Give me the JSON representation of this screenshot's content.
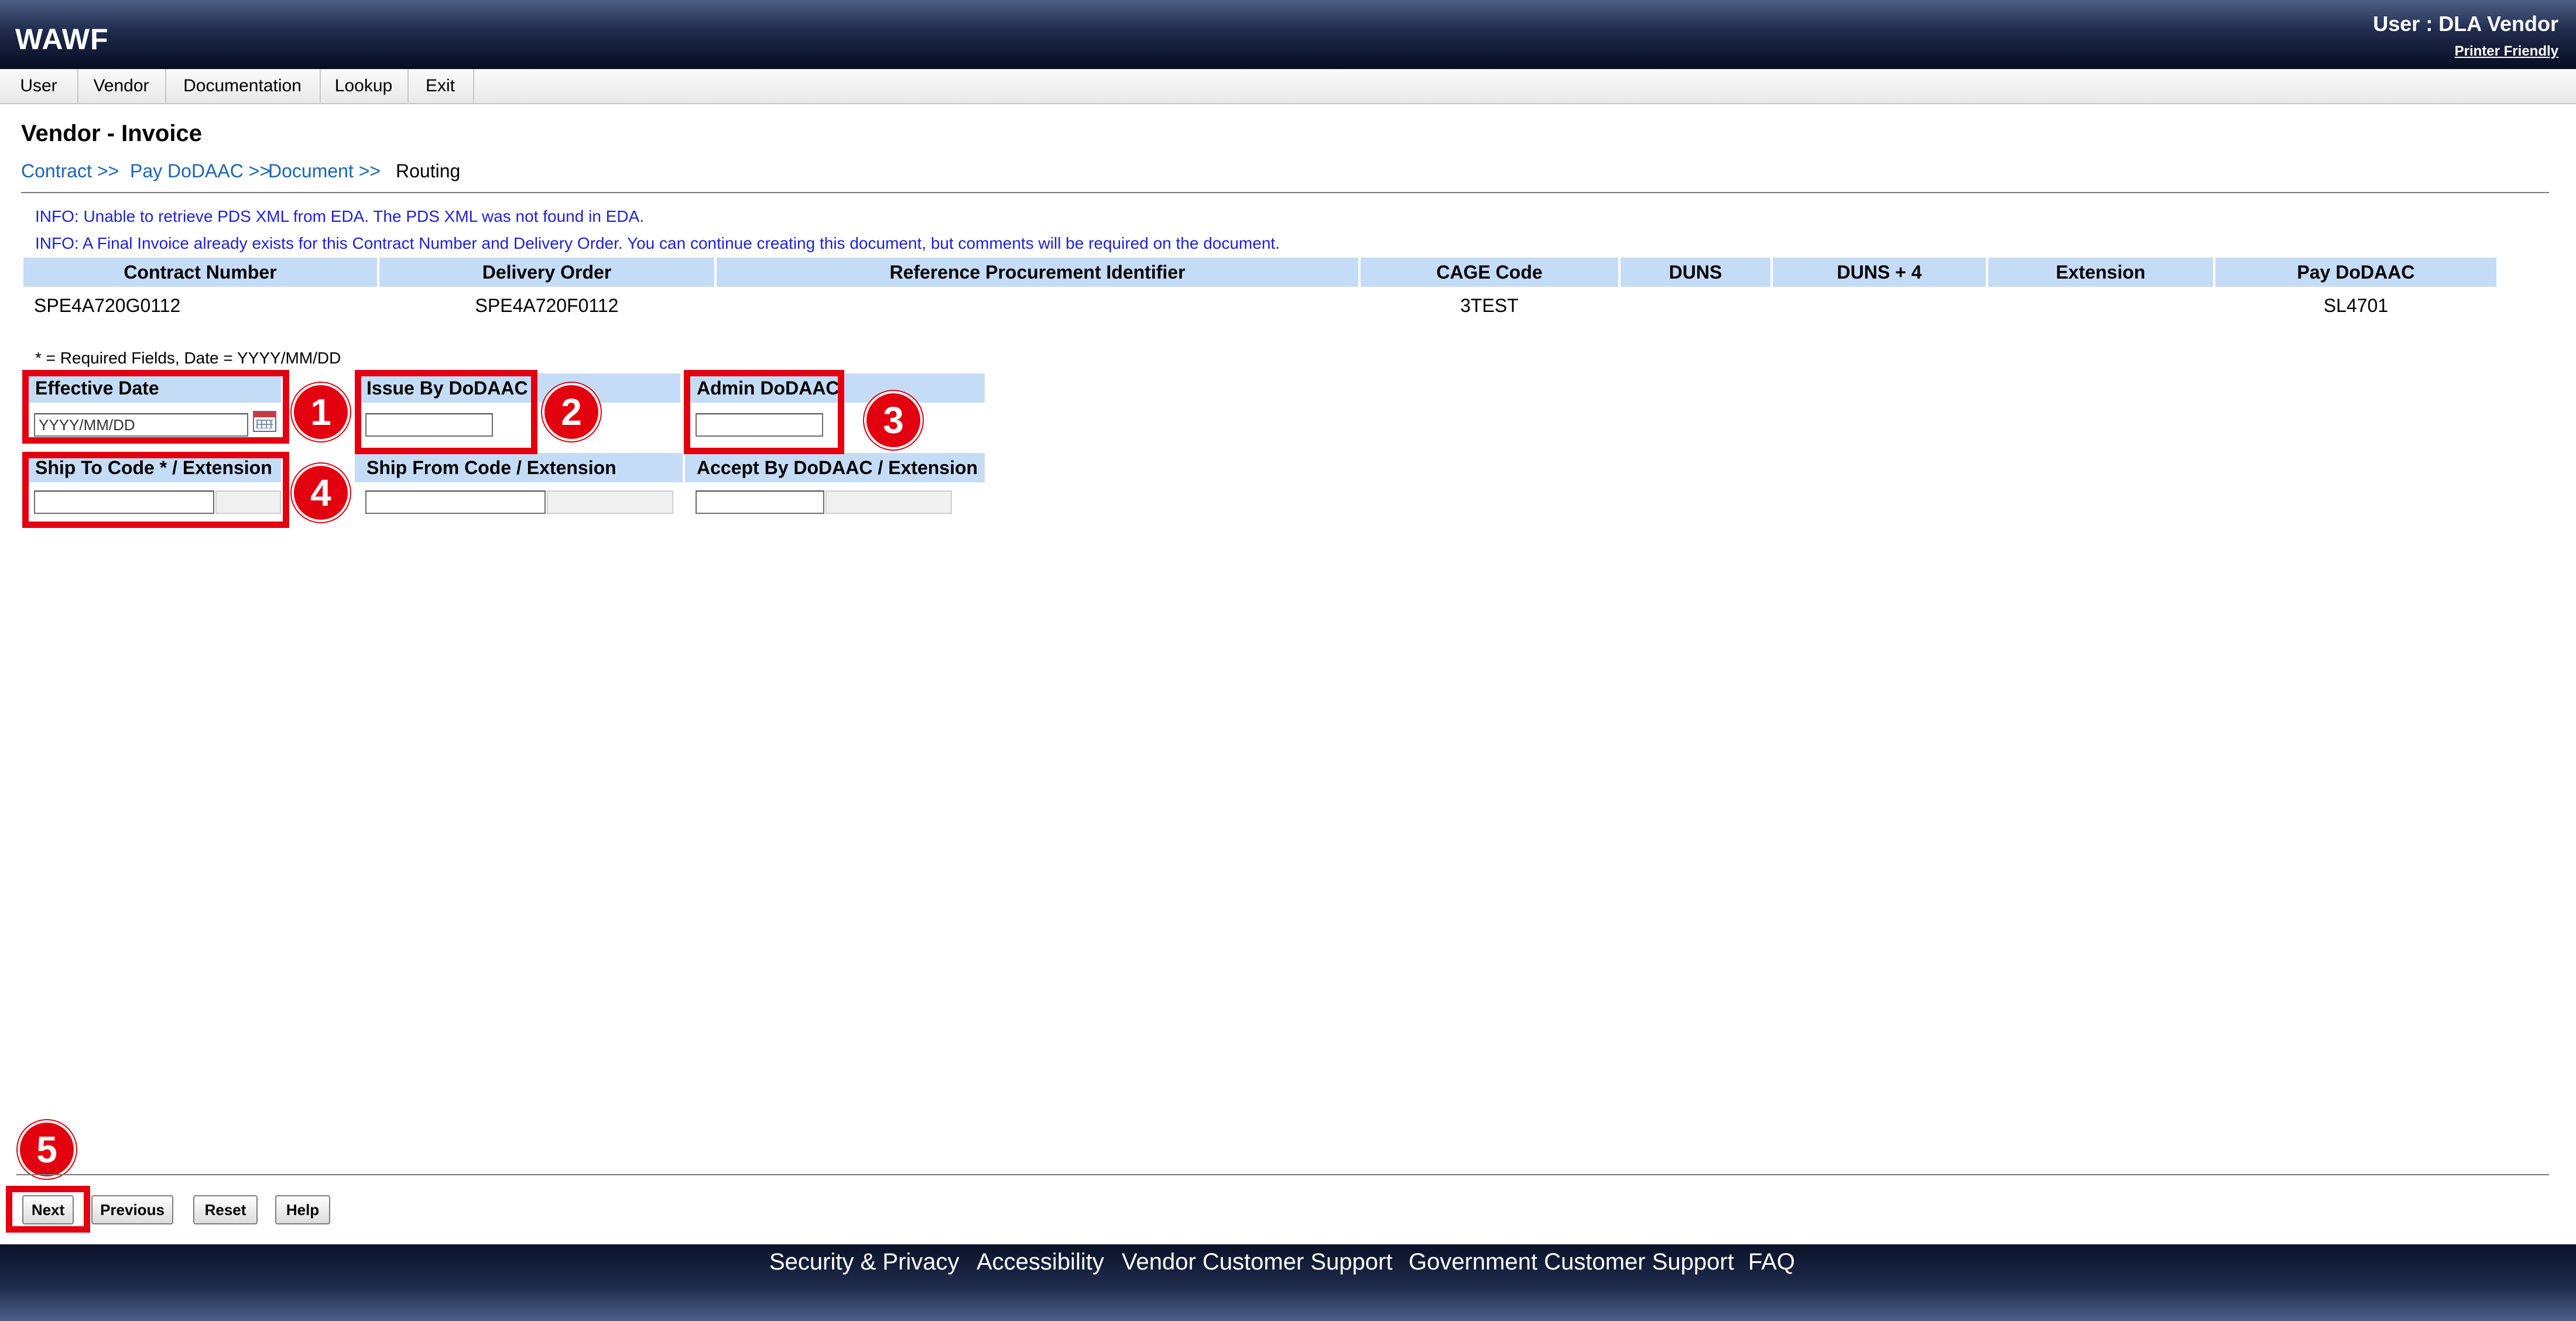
{
  "header": {
    "logo": "WAWF",
    "user_label": "User : DLA Vendor",
    "printer_friendly": "Printer Friendly"
  },
  "menu": {
    "items": [
      {
        "label": "User"
      },
      {
        "label": "Vendor"
      },
      {
        "label": "Documentation"
      },
      {
        "label": "Lookup"
      },
      {
        "label": "Exit"
      }
    ]
  },
  "page": {
    "title": "Vendor - Invoice",
    "breadcrumb": [
      {
        "label": "Contract >>"
      },
      {
        "label": "Pay DoDAAC >>"
      },
      {
        "label": "Document >>"
      },
      {
        "label": "Routing"
      }
    ],
    "info_messages": [
      "INFO: Unable to retrieve PDS XML from EDA. The PDS XML was not found in EDA.",
      "INFO: A Final Invoice already exists for this Contract Number and Delivery Order. You can continue creating this document, but comments will be required on the document."
    ]
  },
  "contract_table": {
    "headers": [
      "Contract Number",
      "Delivery Order",
      "Reference Procurement Identifier",
      "CAGE Code",
      "DUNS",
      "DUNS + 4",
      "Extension",
      "Pay DoDAAC"
    ],
    "row": [
      "SPE4A720G0112",
      "SPE4A720F0112",
      "",
      "3TEST",
      "",
      "",
      "",
      "SL4701"
    ]
  },
  "form": {
    "required_note": "* = Required Fields, Date = YYYY/MM/DD",
    "effective_date": {
      "label": "Effective Date",
      "value": "",
      "placeholder": "YYYY/MM/DD"
    },
    "issue_by": {
      "label": "Issue By DoDAAC",
      "value": ""
    },
    "admin": {
      "label": "Admin DoDAAC",
      "value": ""
    },
    "ship_to": {
      "label": "Ship To Code * / Extension",
      "value": ""
    },
    "ship_from": {
      "label": "Ship From Code / Extension",
      "value": ""
    },
    "accept_by": {
      "label": "Accept By DoDAAC / Extension",
      "value": ""
    }
  },
  "annotations": [
    "1",
    "2",
    "3",
    "4",
    "5"
  ],
  "buttons": {
    "next": "Next",
    "previous": "Previous",
    "reset": "Reset",
    "help": "Help"
  },
  "footer": {
    "links": [
      "Security & Privacy",
      "Accessibility",
      "Vendor Customer Support",
      "Government Customer Support",
      "FAQ"
    ]
  },
  "colors": {
    "annotation_red": "#e3000f",
    "header_blue": "#c5dcf6",
    "link_blue": "#1a66b3",
    "info_blue": "#1f1fd6"
  }
}
